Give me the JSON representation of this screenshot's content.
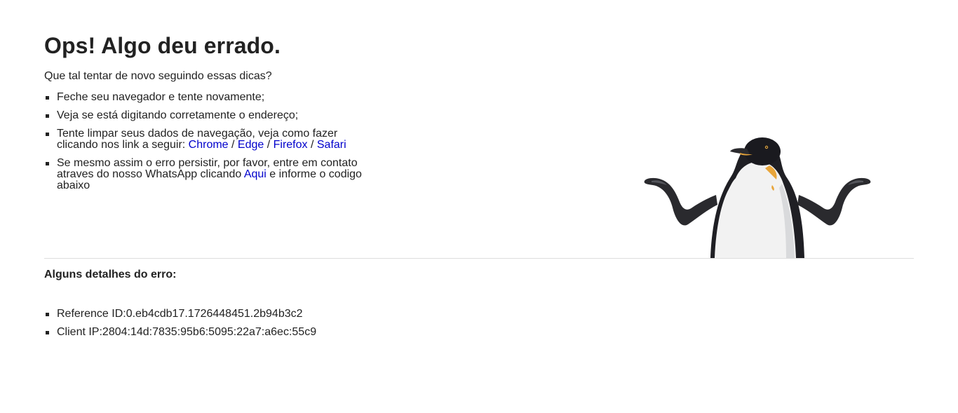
{
  "heading": "Ops! Algo deu errado.",
  "intro": "Que tal tentar de novo seguindo essas dicas?",
  "tips": {
    "item1": "Feche seu navegador e tente novamente;",
    "item2": "Veja se está digitando corretamente o endereço;",
    "item3_text": "Tente limpar seus dados de navegação, veja como fazer clicando nos link a seguir: ",
    "item3_links": {
      "chrome": "Chrome",
      "edge": "Edge",
      "firefox": "Firefox",
      "safari": "Safari",
      "separator": " / "
    },
    "item4_text_before": "Se mesmo assim o erro persistir, por favor, entre em contato atraves do nosso WhatsApp clicando ",
    "item4_link": "Aqui",
    "item4_text_after": " e informe o codigo abaixo"
  },
  "details": {
    "title": "Alguns detalhes do erro:",
    "reference_id": "Reference ID:0.eb4cdb17.1726448451.2b94b3c2",
    "client_ip": "Client IP:2804:14d:7835:95b6:5095:22a7:a6ec:55c9"
  },
  "illustration": {
    "icon": "penguin-shrug-image"
  },
  "colors": {
    "text": "#222222",
    "link": "#0000cc",
    "divider": "#dddddd",
    "background": "#ffffff"
  }
}
